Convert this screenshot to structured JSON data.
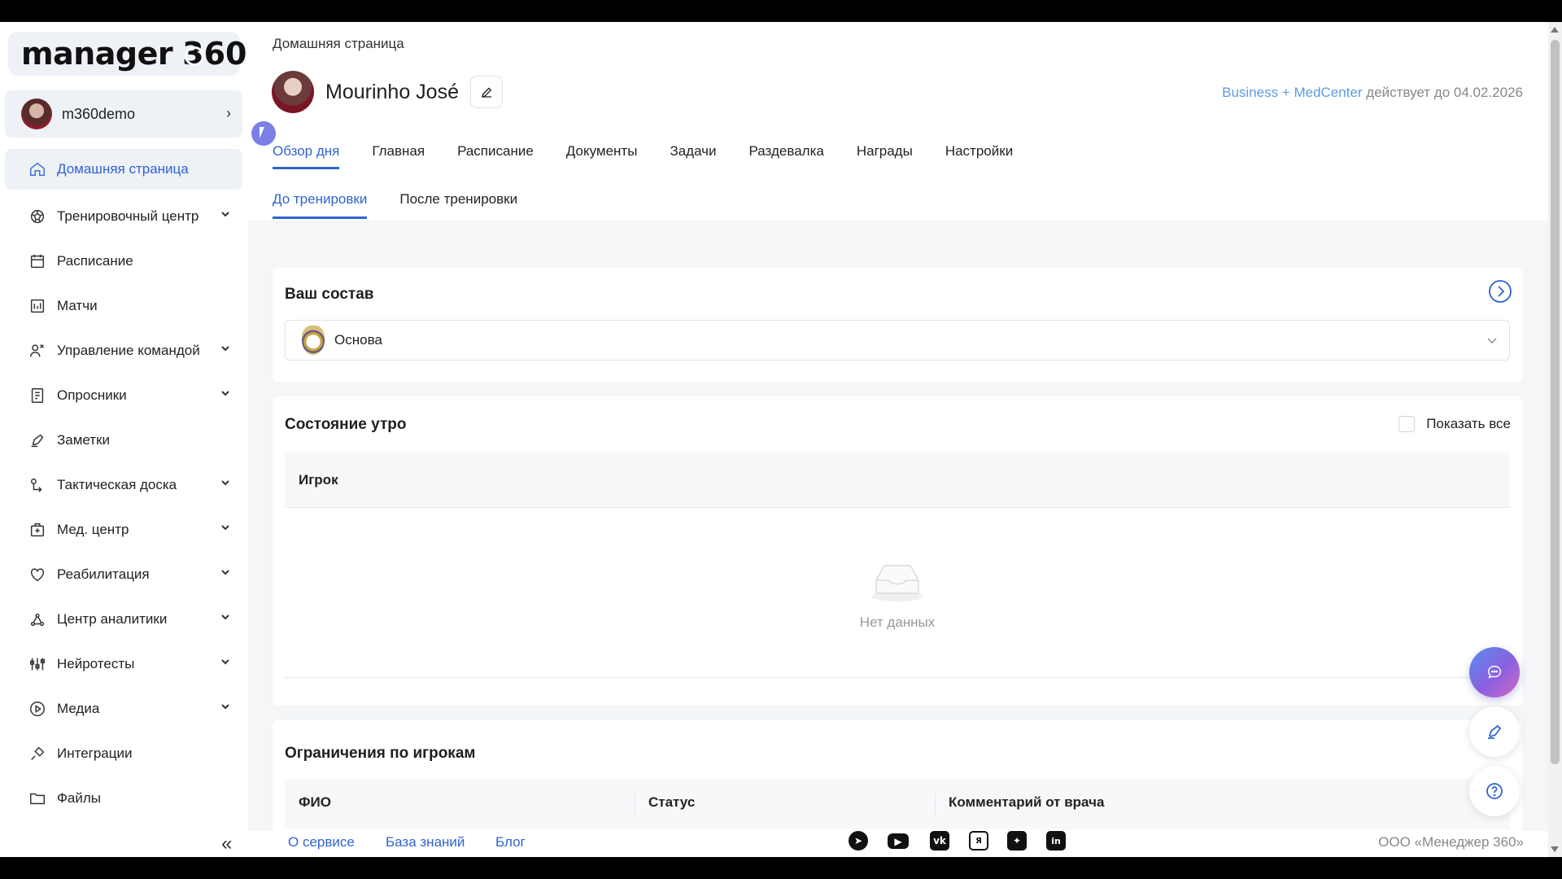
{
  "brand": {
    "logo_text": "manager",
    "logo_num": "360"
  },
  "user": {
    "name": "m360demo"
  },
  "sidebar": {
    "items": [
      {
        "label": "Домашняя страница",
        "icon": "home-icon",
        "active": true,
        "expandable": false
      },
      {
        "label": "Тренировочный центр",
        "icon": "ball-icon",
        "expandable": true
      },
      {
        "label": "Расписание",
        "icon": "calendar-icon",
        "expandable": false
      },
      {
        "label": "Матчи",
        "icon": "scoreboard-icon",
        "expandable": false
      },
      {
        "label": "Управление командой",
        "icon": "team-icon",
        "expandable": true
      },
      {
        "label": "Опросники",
        "icon": "survey-icon",
        "expandable": true
      },
      {
        "label": "Заметки",
        "icon": "pen-icon",
        "expandable": false
      },
      {
        "label": "Тактическая доска",
        "icon": "tactics-icon",
        "expandable": true
      },
      {
        "label": "Мед. центр",
        "icon": "medkit-icon",
        "expandable": true
      },
      {
        "label": "Реабилитация",
        "icon": "heart-icon",
        "expandable": true
      },
      {
        "label": "Центр аналитики",
        "icon": "analytics-icon",
        "expandable": true
      },
      {
        "label": "Нейротесты",
        "icon": "sliders-icon",
        "expandable": true
      },
      {
        "label": "Медиа",
        "icon": "play-icon",
        "expandable": true
      },
      {
        "label": "Интеграции",
        "icon": "plug-icon",
        "expandable": false
      },
      {
        "label": "Файлы",
        "icon": "folder-icon",
        "expandable": false
      }
    ]
  },
  "header": {
    "breadcrumb": "Домашняя страница",
    "profile_name": "Mourinho José",
    "license_plan": "Business + MedCenter",
    "license_rest": " действует до 04.02.2026"
  },
  "tabs": [
    "Обзор дня",
    "Главная",
    "Расписание",
    "Документы",
    "Задачи",
    "Раздевалка",
    "Награды",
    "Настройки"
  ],
  "subtabs": [
    "До тренировки",
    "После тренировки"
  ],
  "squad": {
    "title": "Ваш состав",
    "selected": "Основа"
  },
  "morning": {
    "title": "Состояние утро",
    "show_all": "Показать все",
    "column": "Игрок",
    "empty": "Нет данных"
  },
  "restrictions": {
    "title": "Ограничения по игрокам",
    "columns": [
      "ФИО",
      "Статус",
      "Комментарий от врача"
    ]
  },
  "footer": {
    "links": [
      "О сервисе",
      "База знаний",
      "Блог"
    ],
    "copyright": "ООО «Менеджер 360»"
  },
  "colors": {
    "accent": "#2f64d0",
    "plan": "#5e9be0",
    "active_bg": "#eef1f6"
  }
}
